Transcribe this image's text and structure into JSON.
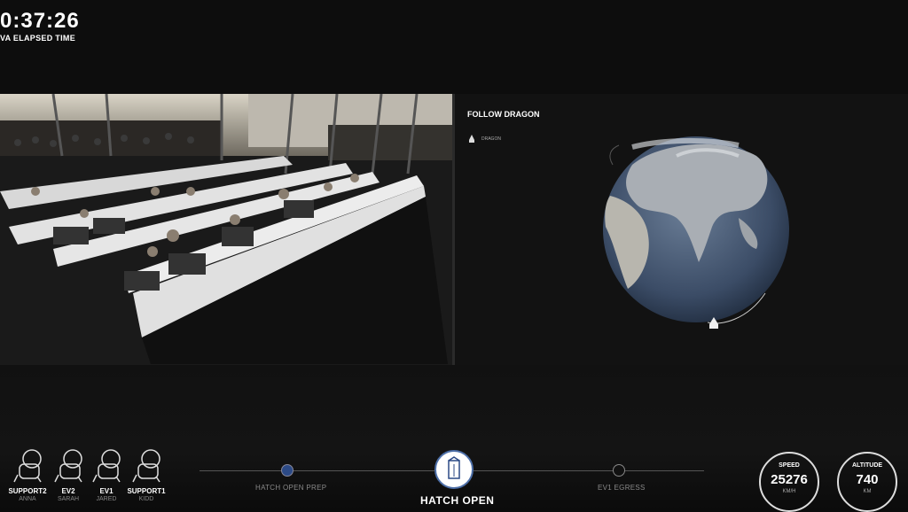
{
  "timer": {
    "value": "0:37:26",
    "label": "VA ELAPSED TIME"
  },
  "map": {
    "title": "FOLLOW DRAGON",
    "legend_label": "DRAGON"
  },
  "crew": [
    {
      "role": "SUPPORT2",
      "name": "ANNA"
    },
    {
      "role": "EV2",
      "name": "SARAH"
    },
    {
      "role": "EV1",
      "name": "JARED"
    },
    {
      "role": "SUPPORT1",
      "name": "KIDD"
    }
  ],
  "timeline": {
    "previous": "HATCH OPEN PREP",
    "current": "HATCH OPEN",
    "next": "EV1 EGRESS"
  },
  "gauges": {
    "speed": {
      "label": "SPEED",
      "value": "25276",
      "unit": "KM/H"
    },
    "altitude": {
      "label": "ALTITUDE",
      "value": "740",
      "unit": "KM"
    }
  }
}
